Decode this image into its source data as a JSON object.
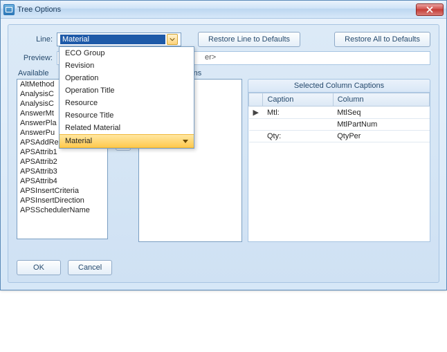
{
  "window": {
    "title": "Tree Options"
  },
  "labels": {
    "line": "Line:",
    "preview": "Preview:",
    "available": "Available",
    "selected_cols": "lumns",
    "grid_title": "Selected Column Captions",
    "caption_col": "Caption",
    "column_col": "Column"
  },
  "combo": {
    "selected": "Material"
  },
  "buttons": {
    "restore_line": "Restore Line to Defaults",
    "restore_all": "Restore All to Defaults",
    "ok": "OK",
    "cancel": "Cancel"
  },
  "preview_text": "er>",
  "dropdown_items": [
    "ECO Group",
    "Revision",
    "Operation",
    "Operation Title",
    "Resource",
    "Resource Title",
    "Related Material",
    "Material"
  ],
  "dropdown_highlight_index": 7,
  "available_items": [
    "AltMethod",
    "AnalysisC",
    "AnalysisC",
    "AnswerMt",
    "AnswerPla",
    "AnswerPu",
    "APSAddResType",
    "APSAttrib1",
    "APSAttrib2",
    "APSAttrib3",
    "APSAttrib4",
    "APSInsertCriteria",
    "APSInsertDirection",
    "APSSchedulerName"
  ],
  "grid_rows": [
    {
      "marker": "▶",
      "caption": "Mtl:",
      "column": "MtlSeq"
    },
    {
      "marker": "",
      "caption": "",
      "column": "MtlPartNum"
    },
    {
      "marker": "",
      "caption": "Qty:",
      "column": "QtyPer"
    }
  ]
}
